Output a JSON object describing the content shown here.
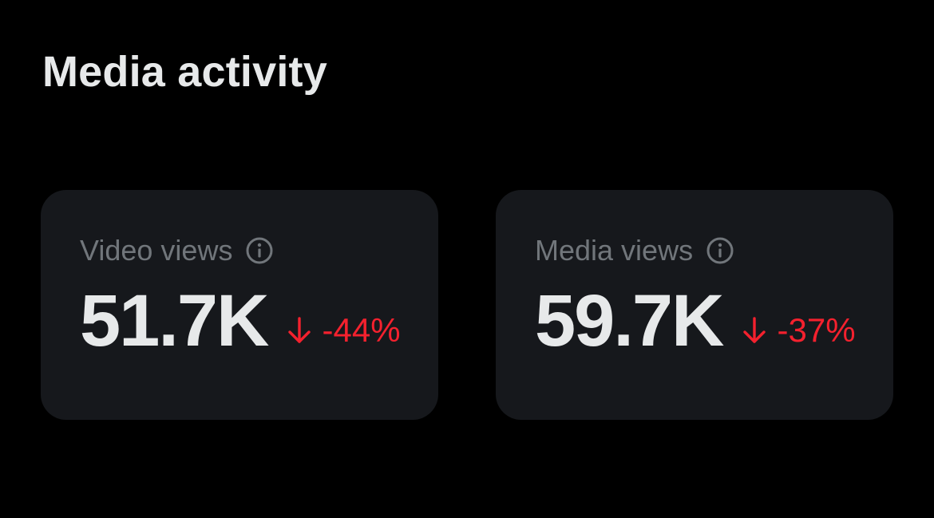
{
  "section": {
    "title": "Media activity"
  },
  "cards": [
    {
      "label": "Video views",
      "value": "51.7K",
      "change": "-44%",
      "change_direction": "down",
      "info_icon": "info-icon",
      "arrow_icon": "arrow-down-icon"
    },
    {
      "label": "Media views",
      "value": "59.7K",
      "change": "-37%",
      "change_direction": "down",
      "info_icon": "info-icon",
      "arrow_icon": "arrow-down-icon"
    }
  ],
  "colors": {
    "background": "#000000",
    "card": "#16181c",
    "title": "#e7e9ea",
    "label": "#71767b",
    "negative": "#f4212e"
  }
}
